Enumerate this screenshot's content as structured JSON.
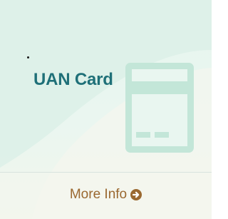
{
  "tile": {
    "title": "UAN Card",
    "more_info_label": "More Info",
    "icon": "credit-card-icon",
    "link_icon": "circle-arrow-right-icon"
  },
  "colors": {
    "background": "#e6f5ee",
    "title": "#1f7078",
    "link": "#9a6830",
    "card_icon": "#bfe3d6"
  }
}
